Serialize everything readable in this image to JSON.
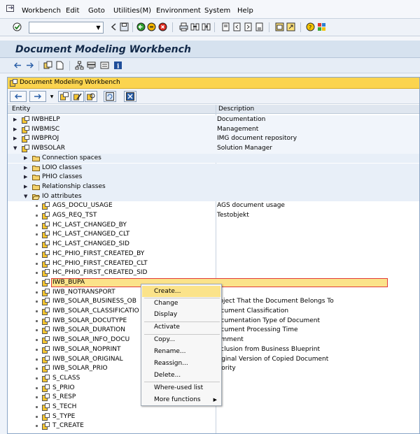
{
  "menubar": {
    "items": [
      "Workbench",
      "Edit",
      "Goto",
      "Utilities(M)",
      "Environment",
      "System",
      "Help"
    ]
  },
  "toolbar": {
    "command_value": ""
  },
  "title": "Document Modeling Workbench",
  "tree": {
    "title": "Document Modeling Workbench",
    "headers": {
      "entity": "Entity",
      "description": "Description"
    },
    "rows": [
      {
        "name": "IWBHELP",
        "desc": "Documentation"
      },
      {
        "name": "IWBMISC",
        "desc": "Management"
      },
      {
        "name": "IWBPROJ",
        "desc": "IMG document repository"
      },
      {
        "name": "IWBSOLAR",
        "desc": "Solution Manager"
      },
      {
        "name": "Connection spaces",
        "desc": ""
      },
      {
        "name": "LOIO classes",
        "desc": ""
      },
      {
        "name": "PHIO classes",
        "desc": ""
      },
      {
        "name": "Relationship classes",
        "desc": ""
      },
      {
        "name": "IO attributes",
        "desc": ""
      },
      {
        "name": "AGS_DOCU_USAGE",
        "desc": "AGS document usage"
      },
      {
        "name": "AGS_REQ_TST",
        "desc": "Testobjekt"
      },
      {
        "name": "HC_LAST_CHANGED_BY",
        "desc": ""
      },
      {
        "name": "HC_LAST_CHANGED_CLT",
        "desc": ""
      },
      {
        "name": "HC_LAST_CHANGED_SID",
        "desc": ""
      },
      {
        "name": "HC_PHIO_FIRST_CREATED_BY",
        "desc": ""
      },
      {
        "name": "HC_PHIO_FIRST_CREATED_CLT",
        "desc": ""
      },
      {
        "name": "HC_PHIO_FIRST_CREATED_SID",
        "desc": ""
      },
      {
        "name": "IWB_BUPA",
        "desc": ""
      },
      {
        "name": "IWB_NOTRANSPORT",
        "desc": ""
      },
      {
        "name": "IWB_SOLAR_BUSINESS_OB",
        "desc": "roject That the Document Belongs To"
      },
      {
        "name": "IWB_SOLAR_CLASSIFICATIO",
        "desc": "ocument Classification"
      },
      {
        "name": "IWB_SOLAR_DOCUTYPE",
        "desc": "ocumentation Type of Document"
      },
      {
        "name": "IWB_SOLAR_DURATION",
        "desc": "ocument Processing Time"
      },
      {
        "name": "IWB_SOLAR_INFO_DOCU",
        "desc": "omment"
      },
      {
        "name": "IWB_SOLAR_NOPRINT",
        "desc": "xclusion from Business Blueprint"
      },
      {
        "name": "IWB_SOLAR_ORIGINAL",
        "desc": "riginal Version of Copied Document"
      },
      {
        "name": "IWB_SOLAR_PRIO",
        "desc": "riority"
      },
      {
        "name": "S_CLASS",
        "desc": ""
      },
      {
        "name": "S_PRIO",
        "desc": ""
      },
      {
        "name": "S_RESP",
        "desc": ""
      },
      {
        "name": "S_TECH",
        "desc": ""
      },
      {
        "name": "S_TYPE",
        "desc": ""
      },
      {
        "name": "T_CREATE",
        "desc": ""
      }
    ]
  },
  "context_menu": {
    "items": [
      "Create...",
      "Change",
      "Display",
      "Activate",
      "Copy...",
      "Rename...",
      "Reassign...",
      "Delete...",
      "Where-used list",
      "More functions"
    ]
  },
  "colors": {
    "title_bg": "#d6e2ef",
    "tree_title_bg": "#fbd44f",
    "selection": "#fbe38a",
    "selection_border": "#e23a3a"
  }
}
